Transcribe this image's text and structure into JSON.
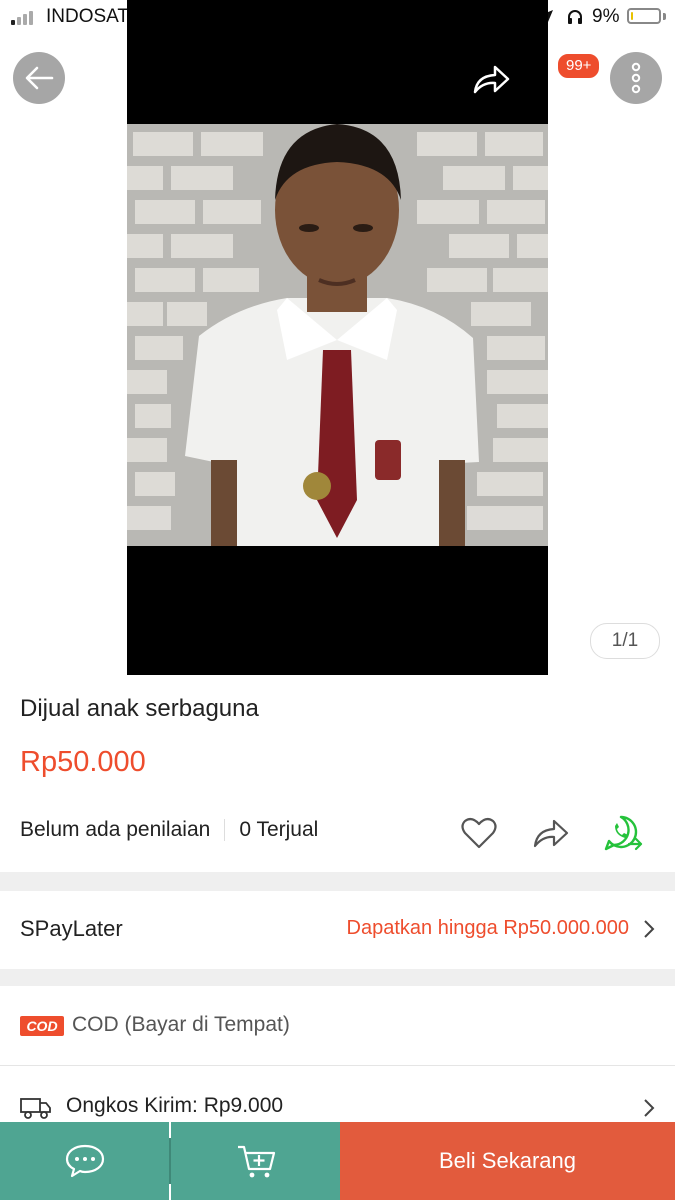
{
  "status_bar": {
    "carrier": "INDOSAT",
    "battery_percent": "9%",
    "battery_level": 0.09
  },
  "gallery": {
    "counter": "1/1",
    "cart_badge": "99+"
  },
  "product": {
    "title": "Dijual anak serbaguna",
    "price": "Rp50.000",
    "rating_text": "Belum ada penilaian",
    "sold_text": "0 Terjual"
  },
  "spaylater": {
    "label": "SPayLater",
    "offer": "Dapatkan hingga Rp50.000.000"
  },
  "cod": {
    "badge": "COD",
    "label": "COD (Bayar di Tempat)"
  },
  "shipping": {
    "label": "Ongkos Kirim: Rp9.000"
  },
  "bottom_bar": {
    "buy_label": "Beli Sekarang"
  },
  "colors": {
    "brand": "#ee4d2d",
    "bottom_green": "#4fa592",
    "buy_button": "#e25b3d",
    "whatsapp": "#25c23b"
  },
  "icons": [
    "back-arrow-icon",
    "share-icon",
    "cart-icon",
    "more-vertical-icon",
    "heart-icon",
    "whatsapp-icon",
    "chevron-right-icon",
    "truck-icon",
    "chat-icon",
    "add-to-cart-icon"
  ]
}
